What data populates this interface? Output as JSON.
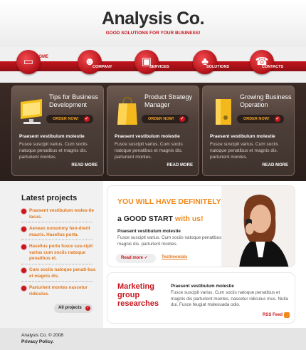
{
  "header": {
    "logo": "Analysis Co.",
    "tagline": "GOOD SOLUTIONS FOR YOUR BUSINESS!"
  },
  "nav": {
    "home": "HOME",
    "items": [
      {
        "label": "COMPANY",
        "icon": "user-icon"
      },
      {
        "label": "SERVICES",
        "icon": "briefcase-icon"
      },
      {
        "label": "SOLUTIONS",
        "icon": "bell-icon"
      },
      {
        "label": "CONTACTS",
        "icon": "phone-icon"
      }
    ],
    "first_icon": "monitor-icon"
  },
  "panels": [
    {
      "title": "Tips for Business Development",
      "order": "ORDER NOW!",
      "heading": "Praesent vestibulum molestie",
      "text": "Fusce suscipit varius. Cum sociis natoque penatibus et magnis dis. parturient montes.",
      "more": "READ MORE"
    },
    {
      "title": "Product Strategy Manager",
      "order": "ORDER NOW!",
      "heading": "Praesent vestibulum molestie",
      "text": "Fusce suscipit varius. Cum sociis natoque penatibus et magnis dis. parturient montes.",
      "more": "READ MORE"
    },
    {
      "title": "Growing Business Operation",
      "order": "ORDER NOW!",
      "heading": "Praesent vestibulum molestie",
      "text": "Fusce suscipit varius. Cum sociis natoque penatibus et magnis dis. parturient montes.",
      "more": "READ MORE"
    }
  ],
  "latest": {
    "title": "Latest projects",
    "items": [
      "Praesent vestibulum moles-tie lacus.",
      "Aenean nonummy hen-drerit mauris. Hasellus porta.",
      "Hasellus porta fusce sus-cipit varius cum sociis natoque penatibus et.",
      "Cum sociis natoque penati-bus et magnis dis.",
      "Parturient montes nascetur ridiculus."
    ],
    "all": "All projects"
  },
  "promo": {
    "line1": "YOU WILL HAVE DEFINITELY",
    "line2a": "a GOOD START",
    "line2b": "with us!",
    "sub": "Praesent vestibulum molestie",
    "text": "Fusce suscipit varius. Cum sociis natoque penatibus et magnis dis. parturient montes.",
    "readmore": "Read more",
    "testimonials": "Testimonials"
  },
  "marketing": {
    "title": "Marketing group researches",
    "sub": "Praesent vestibulum molestie",
    "text": "Fusce suscipit varius. Cum sociis natoque penatibus et magnis dis parturient montes, nascetur ridiculus mus. Nulla dui. Fusce feugiat malesuada odio.",
    "rss": "RSS Feed"
  },
  "footer": {
    "copyright": "Analysis Co. © 2008",
    "privacy": "Privacy Policy."
  },
  "colors": {
    "accent": "#c8161d",
    "orange": "#f08a1c",
    "dark": "#2b1f1b"
  }
}
